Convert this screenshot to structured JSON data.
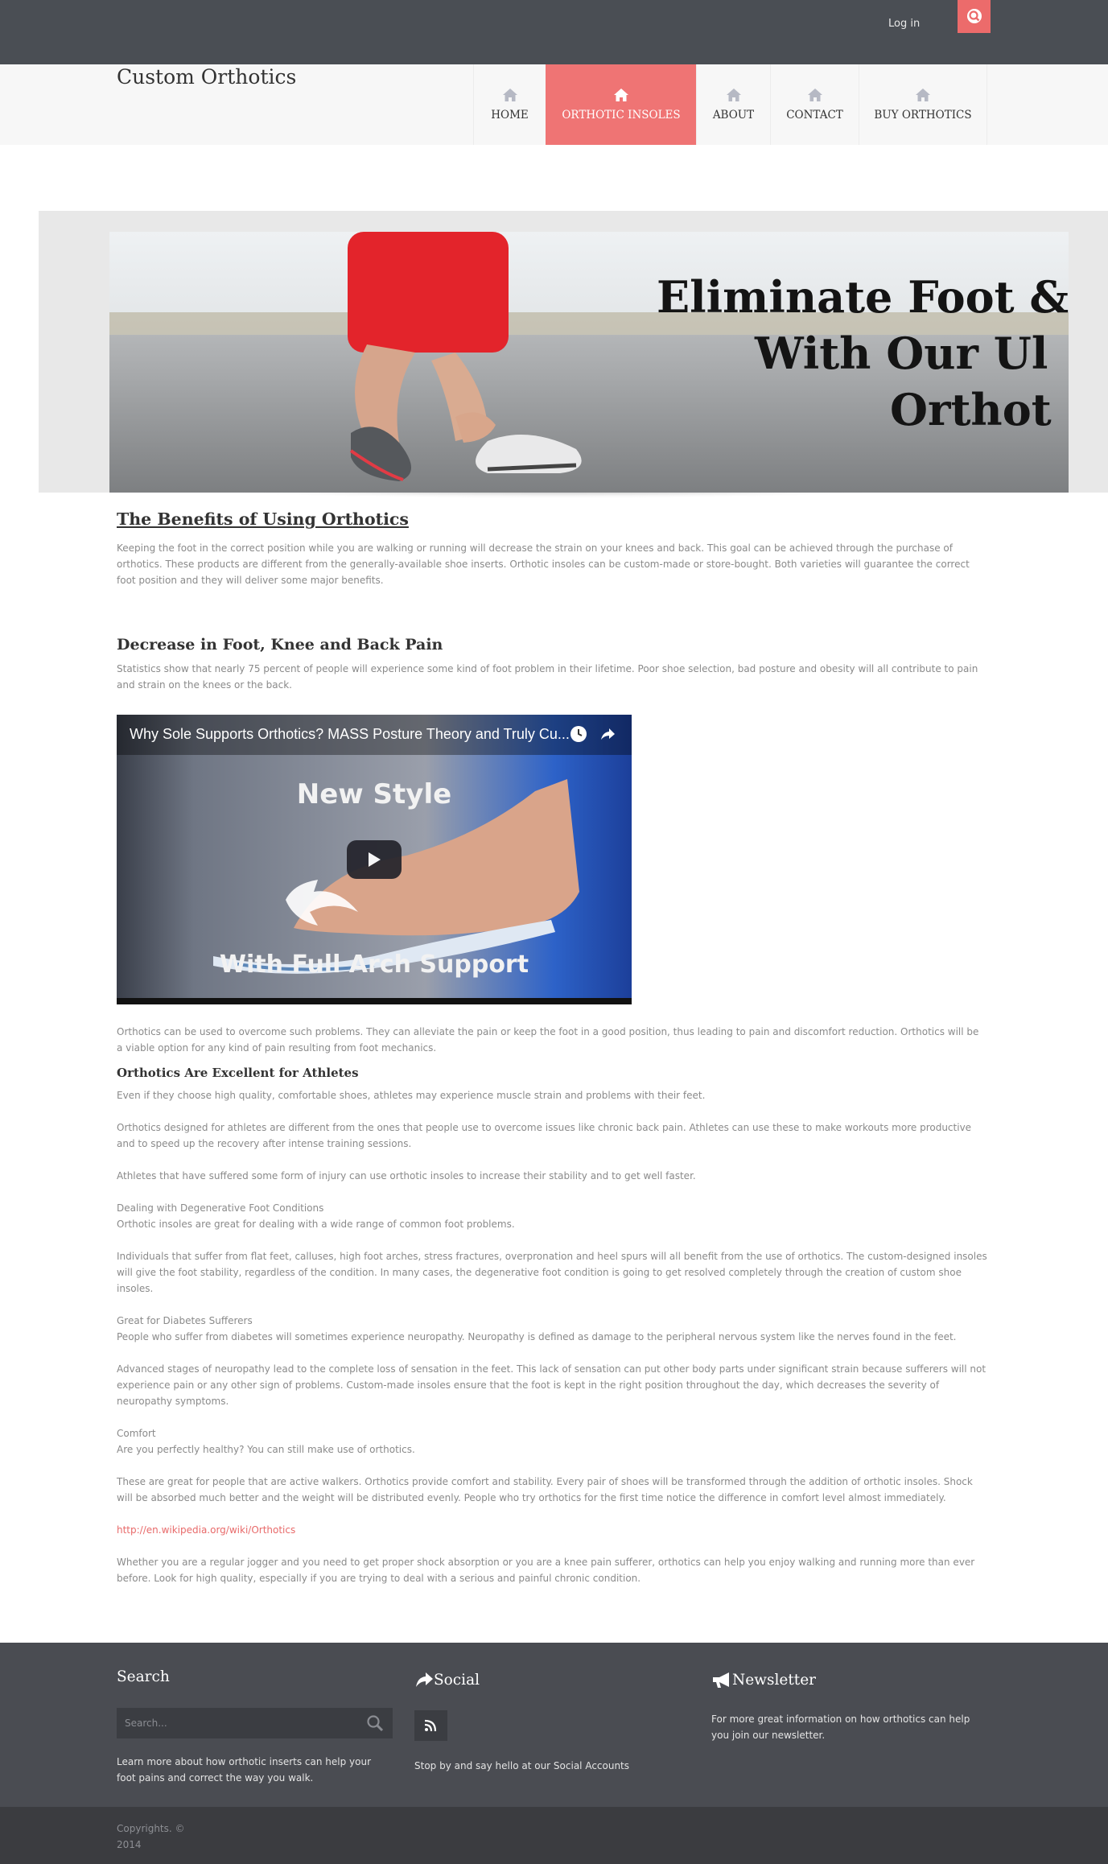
{
  "topbar": {
    "login": "Log in"
  },
  "header": {
    "logo": "Custom Orthotics",
    "nav": [
      {
        "label": "HOME",
        "icon": "home-icon"
      },
      {
        "label": "ORTHOTIC INSOLES",
        "icon": "home-icon",
        "active": true
      },
      {
        "label": "ABOUT",
        "icon": "home-icon"
      },
      {
        "label": "CONTACT",
        "icon": "home-icon"
      },
      {
        "label": "BUY ORTHOTICS",
        "icon": "home-icon"
      }
    ]
  },
  "hero": {
    "banner_line1": "Eliminate Foot &",
    "banner_line2": "With Our Ul",
    "banner_line3": "Orthot"
  },
  "content": {
    "title": "The Benefits of Using Orthotics",
    "intro": "Keeping the foot in the correct position while you are walking or running will decrease the strain on your knees and back. This goal can be achieved through the purchase of orthotics. These products are different from the generally-available shoe inserts. Orthotic insoles can be custom-made or store-bought. Both varieties will guarantee the correct foot position and they will deliver some major benefits.",
    "h2": "Decrease in Foot, Knee and Back Pain",
    "p_stats": "Statistics show that nearly 75 percent of people will experience some kind of foot problem in their lifetime. Poor shoe selection, bad posture and obesity will all contribute to pain and strain on the knees or the back.",
    "video": {
      "title": "Why Sole Supports Orthotics? MASS Posture Theory and Truly Cu...",
      "caption_top": "New Style",
      "caption_bottom": "With Full Arch Support"
    },
    "p_overcome": "Orthotics can be used to overcome such problems. They can alleviate the pain or keep the foot in a good position, thus leading to pain and discomfort reduction. Orthotics will be a viable option for any kind of pain resulting from foot mechanics.",
    "h3_athletes": "Orthotics Are Excellent for Athletes",
    "p_athletes1": "Even if they choose high quality, comfortable shoes, athletes may experience muscle strain and problems with their feet.",
    "p_athletes2": "Orthotics designed for athletes are different from the ones that people use to overcome issues like chronic back pain. Athletes can use these to make workouts more productive and to speed up the recovery after intense training sessions.",
    "p_athletes3": "Athletes that have suffered some form of injury can use orthotic insoles to increase their stability and to get well faster.",
    "sub_degenerative": "Dealing with Degenerative Foot Conditions",
    "p_degenerative1": "Orthotic insoles are great for dealing with a wide range of common foot problems.",
    "p_degenerative2": "Individuals that suffer from flat feet, calluses, high foot arches, stress fractures, overpronation and heel spurs will all benefit from the use of orthotics. The custom-designed insoles will give the foot stability, regardless of the condition. In many cases, the degenerative foot condition is going to get resolved completely through the creation of custom shoe insoles.",
    "sub_diabetes": "Great for Diabetes Sufferers",
    "p_diabetes1": "People who suffer from diabetes will sometimes experience neuropathy. Neuropathy is defined as damage to the peripheral nervous system like the nerves found in the feet.",
    "p_diabetes2": "Advanced stages of neuropathy lead to the complete loss of sensation in the feet. This lack of sensation can put other body parts under significant strain because sufferers will not experience pain or any other sign of problems. Custom-made insoles ensure that the foot is kept in the right position throughout the day, which decreases the severity of neuropathy symptoms.",
    "sub_comfort": "Comfort",
    "p_comfort1": "Are you perfectly healthy? You can still make use of orthotics.",
    "p_comfort2": "These are great for people that are active walkers. Orthotics provide comfort and stability. Every pair of shoes will be transformed through the addition of orthotic insoles. Shock will be absorbed much better and the weight will be distributed evenly. People who try orthotics for the first time notice the difference in comfort level almost immediately.",
    "wiki_link": "http://en.wikipedia.org/wiki/Orthotics",
    "p_final": "Whether you are a regular jogger and you need to get proper shock absorption or you are a knee pain sufferer, orthotics can help you enjoy walking and running more than ever before. Look for high quality, especially if you are trying to deal with a serious and painful chronic condition."
  },
  "footer": {
    "search_title": "Search",
    "search_placeholder": "Search...",
    "search_text": "Learn more about how orthotic inserts can help your foot pains and correct the way you walk.",
    "social_title": "Social",
    "social_text": "Stop by and say hello at our Social Accounts",
    "newsletter_title": "Newsletter",
    "newsletter_text": "For more great information on how orthotics can help you join our newsletter.",
    "copyright": "Copyrights. © 2014"
  },
  "colors": {
    "accent": "#ef7474",
    "topbar": "#4a4e54",
    "footer": "#4a4c52",
    "bottombar": "#3b3c40"
  }
}
